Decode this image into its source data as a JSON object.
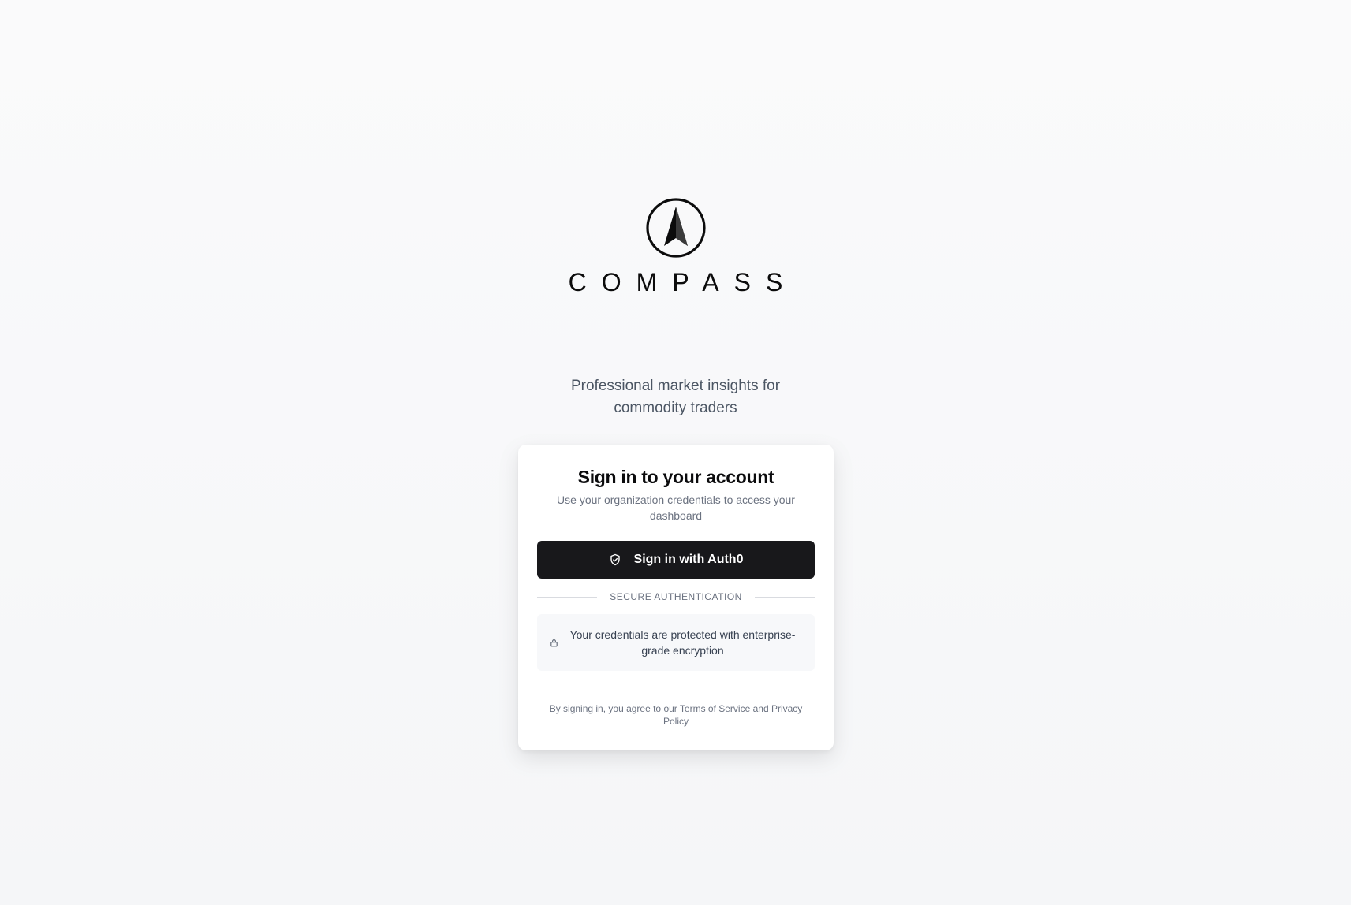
{
  "brand": {
    "name": "COMPASS"
  },
  "tagline": "Professional market insights for commodity traders",
  "card": {
    "title": "Sign in to your account",
    "subtitle": "Use your organization credentials to access your dashboard",
    "signin_button": "Sign in with Auth0",
    "signin_icon": "shield-check-icon",
    "divider_label": "SECURE AUTHENTICATION",
    "secure_note": "Your credentials are protected with enterprise-grade encryption",
    "secure_icon": "lock-icon",
    "terms": "By signing in, you agree to our Terms of Service and Privacy Policy"
  },
  "colors": {
    "button_bg": "#18181b",
    "page_bg": "#f7f8fa",
    "text_muted": "#6b7280"
  }
}
